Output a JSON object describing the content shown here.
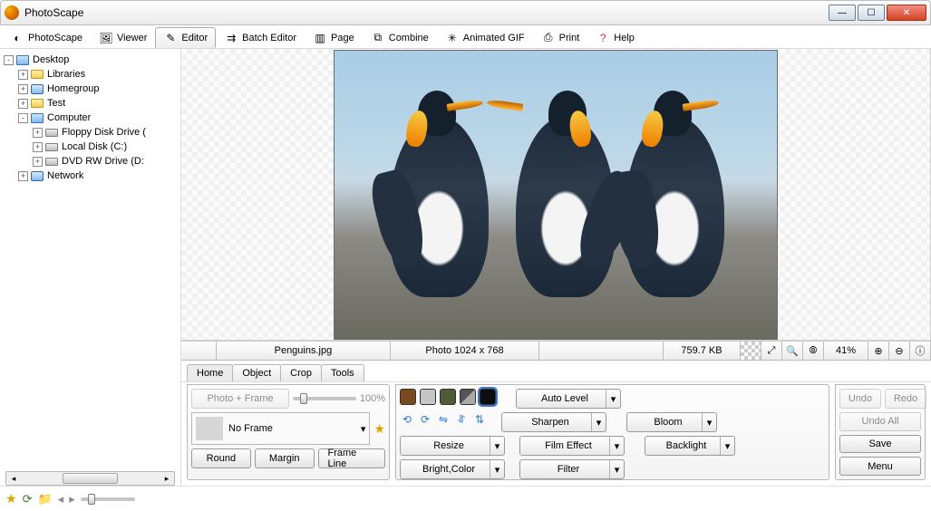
{
  "window": {
    "title": "PhotoScape"
  },
  "toolbar": {
    "tabs": [
      {
        "label": "PhotoScape"
      },
      {
        "label": "Viewer"
      },
      {
        "label": "Editor"
      },
      {
        "label": "Batch Editor"
      },
      {
        "label": "Page"
      },
      {
        "label": "Combine"
      },
      {
        "label": "Animated GIF"
      },
      {
        "label": "Print"
      },
      {
        "label": "Help"
      }
    ],
    "active_index": 2
  },
  "tree": {
    "items": [
      {
        "depth": 0,
        "exp": "-",
        "icon": "desktop",
        "label": "Desktop"
      },
      {
        "depth": 1,
        "exp": "+",
        "icon": "folder",
        "label": "Libraries"
      },
      {
        "depth": 1,
        "exp": "+",
        "icon": "net",
        "label": "Homegroup"
      },
      {
        "depth": 1,
        "exp": "+",
        "icon": "folder",
        "label": "Test"
      },
      {
        "depth": 1,
        "exp": "-",
        "icon": "comp",
        "label": "Computer"
      },
      {
        "depth": 2,
        "exp": "+",
        "icon": "drive",
        "label": "Floppy Disk Drive ("
      },
      {
        "depth": 2,
        "exp": "+",
        "icon": "drive",
        "label": "Local Disk (C:)"
      },
      {
        "depth": 2,
        "exp": "+",
        "icon": "drive",
        "label": "DVD RW Drive (D:"
      },
      {
        "depth": 1,
        "exp": "+",
        "icon": "net",
        "label": "Network"
      }
    ]
  },
  "statusbar": {
    "filename": "Penguins.jpg",
    "resolution": "Photo 1024 x 768",
    "filesize": "759.7 KB",
    "zoom": "41%"
  },
  "editor_tabs": {
    "tabs": [
      "Home",
      "Object",
      "Crop",
      "Tools"
    ],
    "active_index": 0
  },
  "home": {
    "photo_frame_btn": "Photo + Frame",
    "slider_value": "100%",
    "frame_select": "No Frame",
    "round_btn": "Round",
    "margin_btn": "Margin",
    "frame_line_btn": "Frame Line"
  },
  "center": {
    "swatches": [
      "#7a4a1f",
      "#c5c5c5",
      "#4f5a36",
      "#333333",
      "#0d0d0d"
    ],
    "auto_level": "Auto Level",
    "sharpen": "Sharpen",
    "bloom": "Bloom",
    "resize": "Resize",
    "film_effect": "Film Effect",
    "backlight": "Backlight",
    "bright_color": "Bright,Color",
    "filter": "Filter"
  },
  "right": {
    "undo": "Undo",
    "redo": "Redo",
    "undo_all": "Undo All",
    "save": "Save",
    "menu": "Menu"
  }
}
